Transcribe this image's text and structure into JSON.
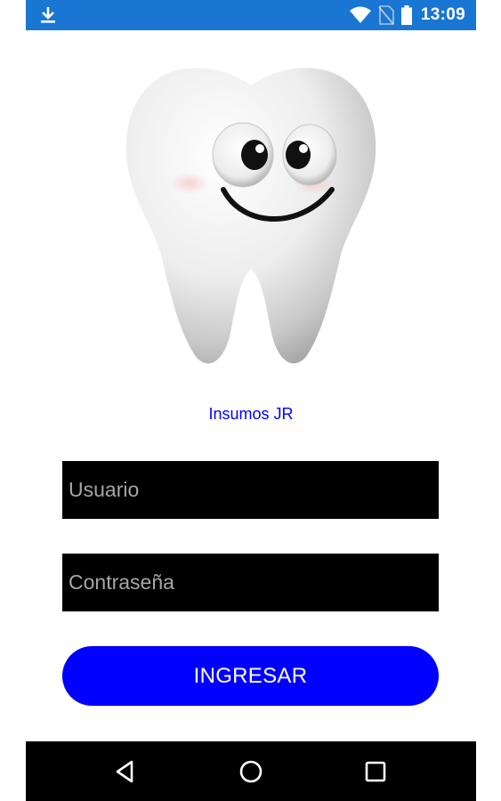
{
  "status_bar": {
    "time": "13:09",
    "icons": [
      "download-icon",
      "wifi-icon",
      "no-sim-icon",
      "battery-icon"
    ],
    "background": "#1976d2"
  },
  "app": {
    "logo": "smiling-tooth-logo",
    "title": "Insumos JR",
    "title_color": "#0000ff"
  },
  "login": {
    "user_placeholder": "Usuario",
    "user_value": "",
    "password_placeholder": "Contraseña",
    "password_value": "",
    "submit_label": "INGRESAR",
    "field_background": "#000000",
    "button_color": "#0000ff"
  },
  "nav_bar": {
    "icons": [
      "back-icon",
      "home-icon",
      "recents-icon"
    ],
    "background": "#000000"
  }
}
